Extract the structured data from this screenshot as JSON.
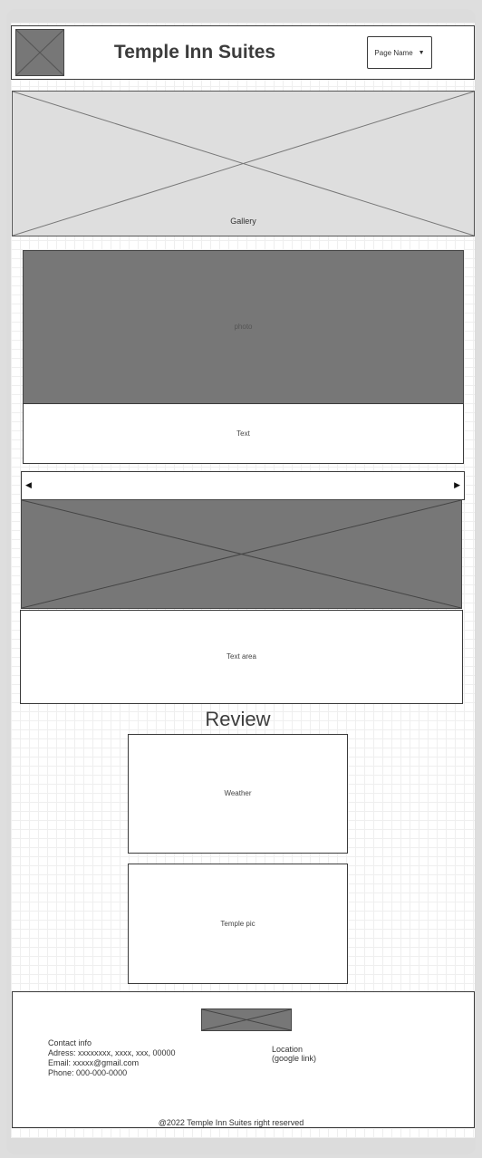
{
  "header": {
    "title": "Temple Inn Suites",
    "page_select": {
      "value": "Page Name"
    }
  },
  "gallery": {
    "label": "Gallery"
  },
  "feature": {
    "photo_label": "photo",
    "text_label": "Text"
  },
  "slider": {
    "prev_glyph": "◀",
    "next_glyph": "▶"
  },
  "text_area": {
    "label": "Text area"
  },
  "review": {
    "title": "Review",
    "weather_label": "Weather",
    "temple_pic_label": "Temple pic"
  },
  "footer": {
    "contact": {
      "heading": "Contact info",
      "address": "Adress: xxxxxxxx, xxxx, xxx, 00000",
      "email": "Email: xxxxx@gmail.com",
      "phone": "Phone: 000-000-0000"
    },
    "location": {
      "heading": "Location",
      "link": "(google link)"
    },
    "copyright": "@2022 Temple Inn Suites right reserved"
  },
  "colors": {
    "placeholder_dark": "#777777",
    "placeholder_light": "#dedede",
    "border": "#3a3a3a"
  },
  "icons": {
    "select_caret": "chevron-down-icon",
    "slider_prev": "arrow-left-icon",
    "slider_next": "arrow-right-icon"
  }
}
